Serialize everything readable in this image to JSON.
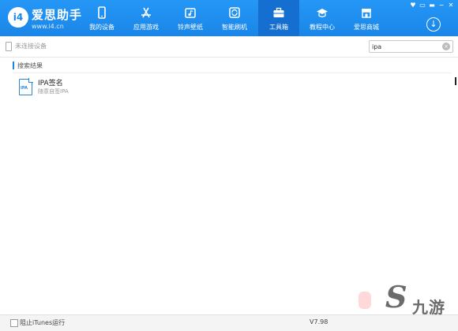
{
  "app": {
    "title": "爱思助手",
    "url": "www.i4.cn",
    "logo_mark": "i4"
  },
  "nav": {
    "items": [
      {
        "label": "我的设备",
        "icon": "phone-icon"
      },
      {
        "label": "应用游戏",
        "icon": "app-store-icon"
      },
      {
        "label": "铃声壁纸",
        "icon": "music-image-icon"
      },
      {
        "label": "智能刷机",
        "icon": "flash-refresh-icon"
      },
      {
        "label": "工具箱",
        "icon": "toolbox-icon",
        "active": true
      },
      {
        "label": "教程中心",
        "icon": "graduation-cap-icon"
      },
      {
        "label": "爱思商城",
        "icon": "store-icon"
      }
    ],
    "download_symbol": "↓"
  },
  "window_controls": [
    "♥",
    "▭",
    "▬",
    "−",
    "✕"
  ],
  "subbar": {
    "device_status": "未连接设备",
    "search_value": "ipa",
    "clear_symbol": "×"
  },
  "results": {
    "section_title": "搜索结果",
    "items": [
      {
        "title": "IPA签名",
        "subtitle": "随意自签IPA",
        "icon_tag": "IPA"
      }
    ]
  },
  "statusbar": {
    "itunes_label": "阻止iTunes运行",
    "version": "V7.98"
  },
  "watermark": {
    "text": "九游"
  },
  "colors": {
    "brand_blue": "#1a86e8",
    "active_tab": "#156fd0"
  }
}
